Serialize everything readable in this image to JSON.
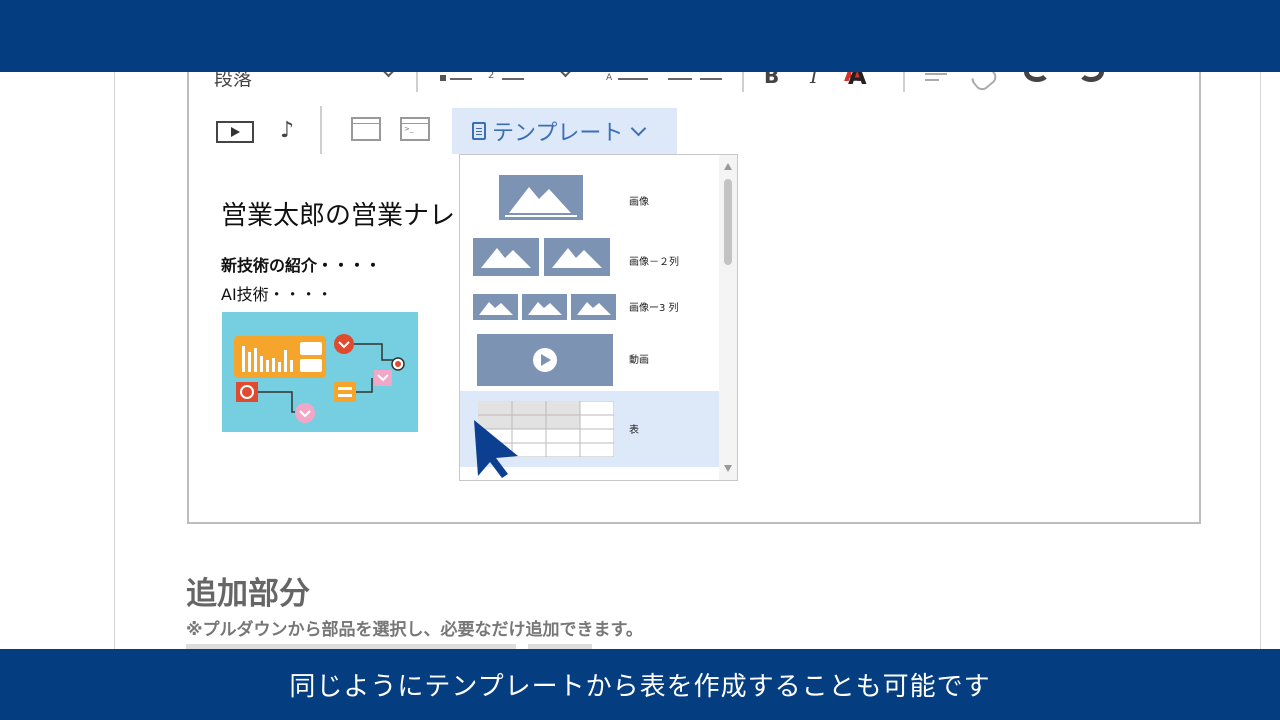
{
  "toolbar": {
    "paragraph_label": "段落",
    "list_number_marker": "2",
    "font_size_marker": "A",
    "bold_label": "B",
    "italic_label": "I",
    "font_color_label": "A",
    "template_label": "テンプレート"
  },
  "document": {
    "title": "営業太郎の営業ナレ",
    "line1": "新技術の紹介・・・・",
    "line2": "AI技術・・・・"
  },
  "template_menu": {
    "items": [
      {
        "label": "画像"
      },
      {
        "label": "画像－２列"
      },
      {
        "label": "画像ー3 列"
      },
      {
        "label": "動画"
      },
      {
        "label": "表"
      }
    ],
    "selected": "表"
  },
  "section": {
    "title": "追加部分",
    "note": "※プルダウンから部品を選択し、必要なだけ追加できます。"
  },
  "caption": "同じようにテンプレートから表を作成することも可能です",
  "colors": {
    "banner": "#043d80",
    "accent": "#3a6fb6",
    "menu_selected": "#dde9f8",
    "thumb": "#7d93b3",
    "cursor": "#0c3f8f"
  }
}
